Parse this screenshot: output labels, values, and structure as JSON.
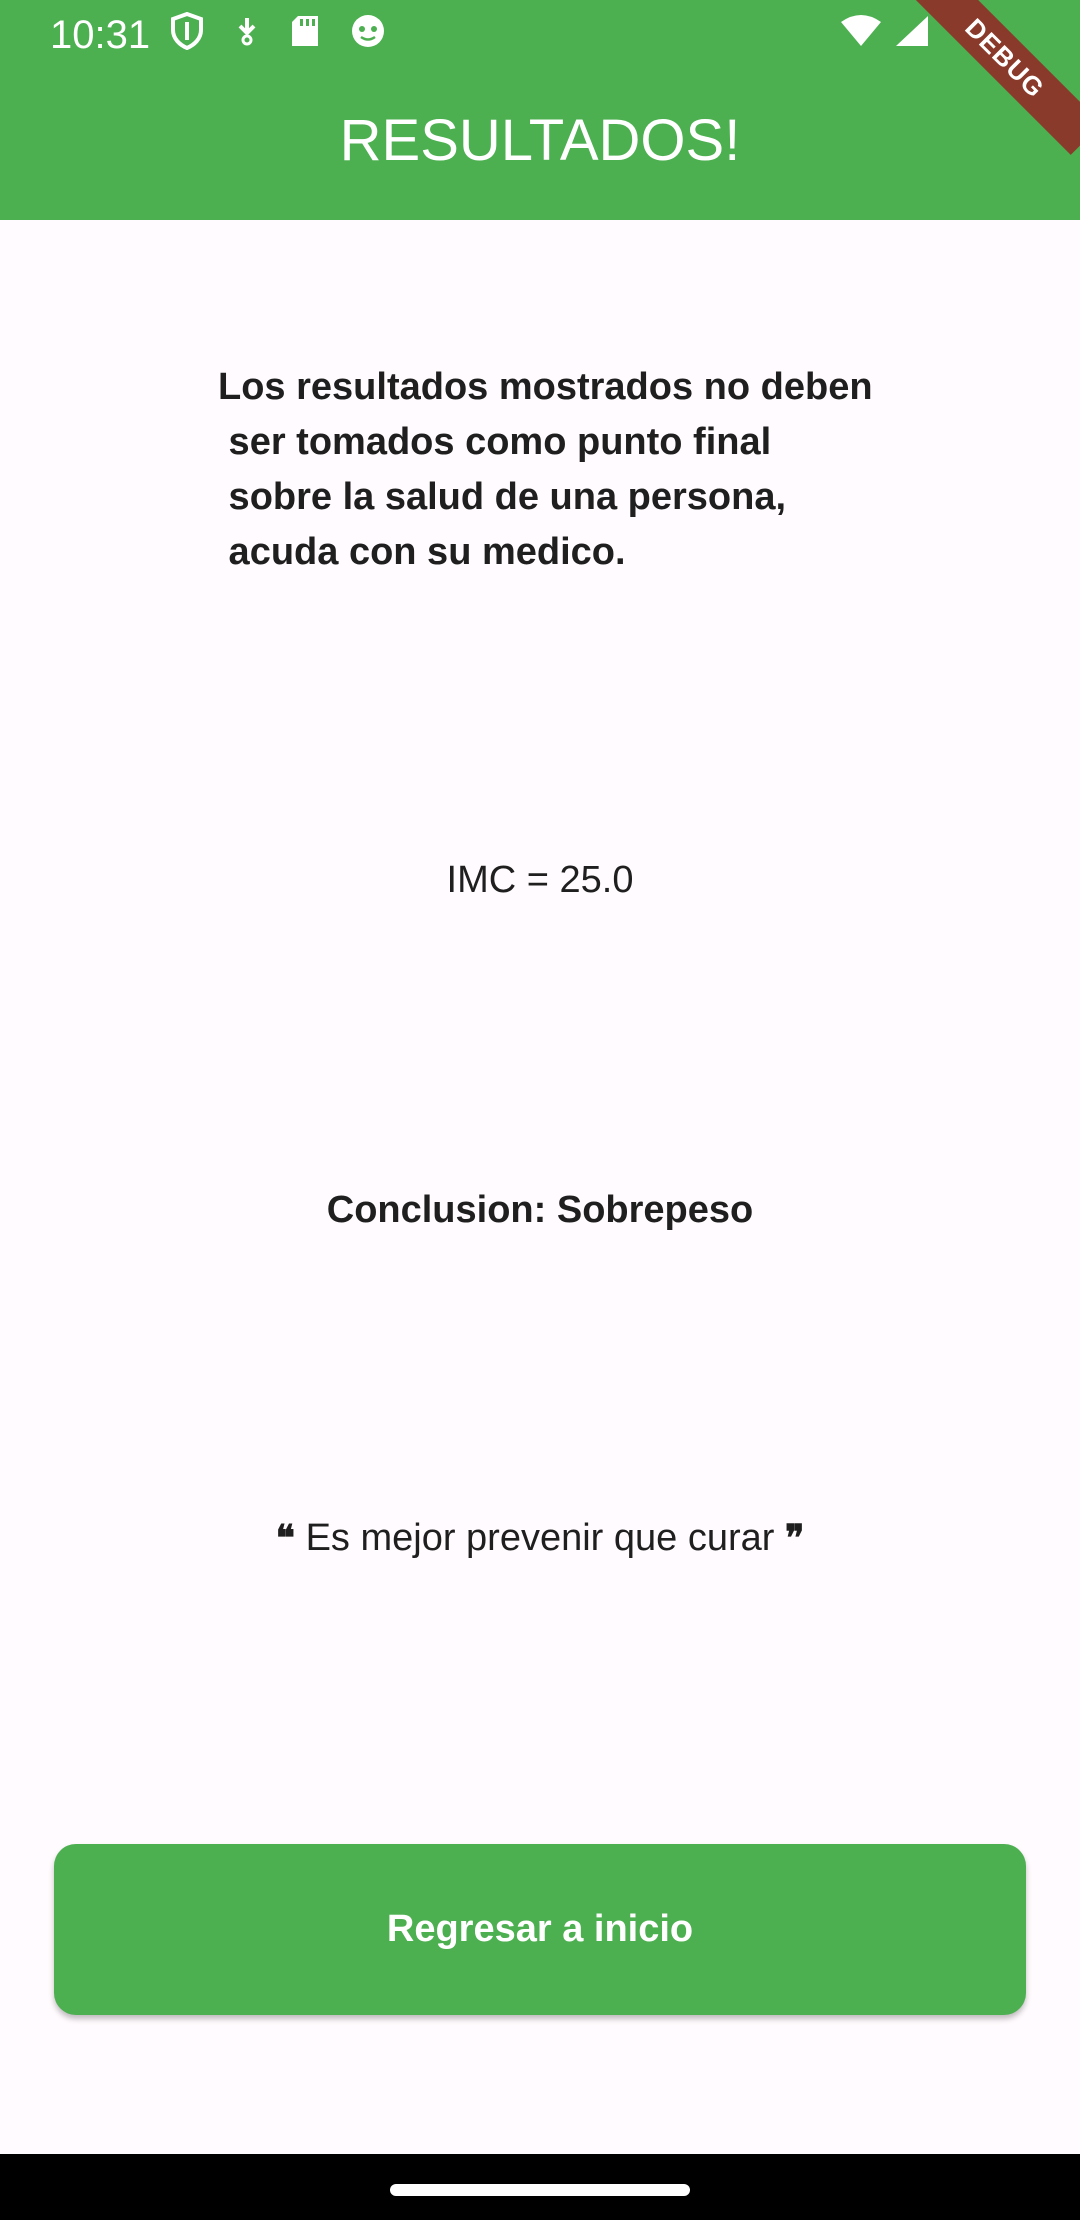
{
  "status_bar": {
    "time": "10:31",
    "icons_left": [
      "shield-icon",
      "download-icon",
      "sd-card-icon",
      "android-icon"
    ],
    "icons_right": [
      "wifi-icon",
      "signal-icon"
    ]
  },
  "app_bar": {
    "title": "RESULTADOS!",
    "debug_label": "DEBUG",
    "color": "#4caf50"
  },
  "main": {
    "disclaimer": "Los resultados mostrados no deben\n ser tomados como punto final\n sobre la salud de una persona,\n acuda con su medico.",
    "imc_text": "IMC = 25.0",
    "conclusion_text": "Conclusion: Sobrepeso",
    "quote_text": "Es mejor prevenir que curar",
    "quote_open": "❝",
    "quote_close": "❞"
  },
  "actions": {
    "back_button_label": "Regresar a inicio"
  }
}
